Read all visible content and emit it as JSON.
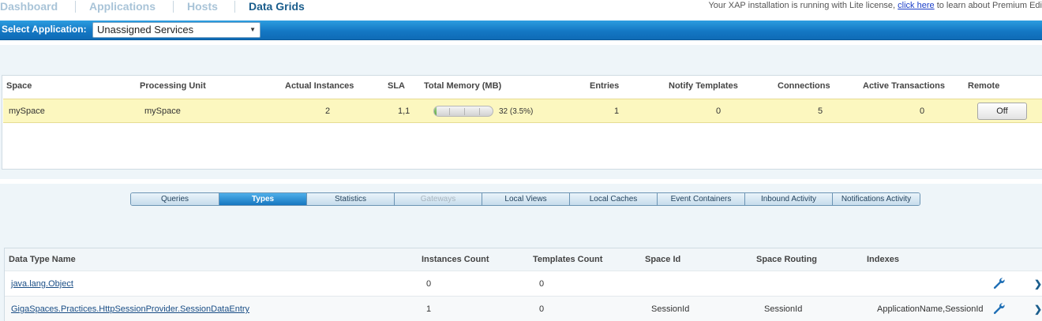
{
  "nav": {
    "tabs": [
      {
        "label": "Dashboard",
        "active": false
      },
      {
        "label": "Applications",
        "active": false
      },
      {
        "label": "Hosts",
        "active": false
      },
      {
        "label": "Data Grids",
        "active": true
      }
    ]
  },
  "license": {
    "prefix": "Your XAP installation is running with Lite license, ",
    "link": "click here",
    "suffix": " to learn about Premium Edi"
  },
  "appbar": {
    "label": "Select Application:",
    "selected": "Unassigned Services"
  },
  "space_grid": {
    "columns": [
      "Space",
      "Processing Unit",
      "Actual Instances",
      "SLA",
      "Total Memory (MB)",
      "Entries",
      "Notify Templates",
      "Connections",
      "Active Transactions",
      "Remote"
    ],
    "row": {
      "space": "mySpace",
      "processing_unit": "mySpace",
      "actual_instances": "2",
      "sla": "1,1",
      "memory_text": "32 (3.5%)",
      "memory_fraction": 0.035,
      "entries": "1",
      "notify_templates": "0",
      "connections": "5",
      "active_transactions": "0",
      "remote_button": "Off"
    }
  },
  "subtabs": [
    {
      "label": "Queries",
      "state": "normal"
    },
    {
      "label": "Types",
      "state": "active"
    },
    {
      "label": "Statistics",
      "state": "normal"
    },
    {
      "label": "Gateways",
      "state": "disabled"
    },
    {
      "label": "Local Views",
      "state": "normal"
    },
    {
      "label": "Local Caches",
      "state": "normal"
    },
    {
      "label": "Event Containers",
      "state": "normal"
    },
    {
      "label": "Inbound Activity",
      "state": "normal"
    },
    {
      "label": "Notifications Activity",
      "state": "normal"
    }
  ],
  "types_grid": {
    "columns": [
      "Data Type Name",
      "Instances Count",
      "Templates Count",
      "Space Id",
      "Space Routing",
      "Indexes"
    ],
    "rows": [
      {
        "name": "java.lang.Object",
        "instances": "0",
        "templates": "0",
        "space_id": "",
        "routing": "",
        "indexes": ""
      },
      {
        "name": "GigaSpaces.Practices.HttpSessionProvider.SessionDataEntry",
        "instances": "1",
        "templates": "0",
        "space_id": "SessionId",
        "routing": "SessionId",
        "indexes": "ApplicationName,SessionId"
      }
    ]
  },
  "colors": {
    "accent": "#1478c4",
    "selected_row": "#fcf7bf",
    "link": "#1a4e86"
  }
}
